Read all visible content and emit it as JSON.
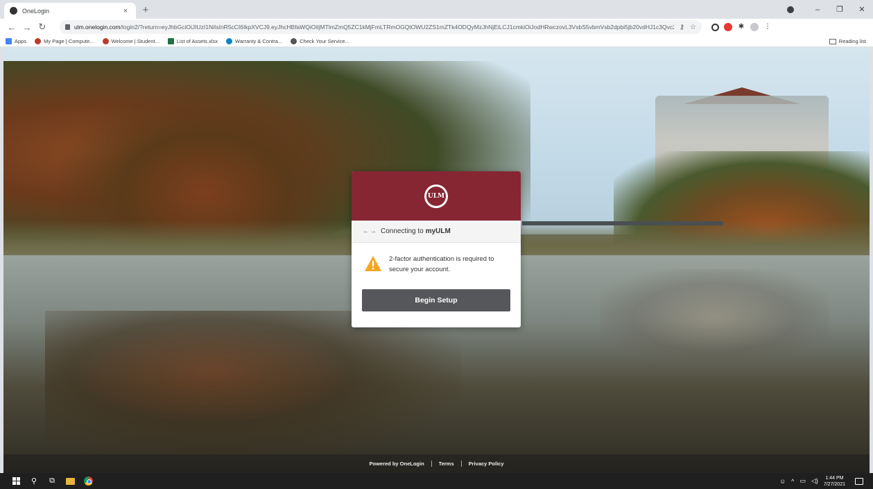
{
  "browser": {
    "tab_title": "OneLogin",
    "tab_close": "×",
    "new_tab": "+",
    "url_host": "ulm.onelogin.com",
    "url_rest": "/login2/?return=eyJhbGciOiJIUzI1NiIsInR5cCI6IkpXVCJ9.eyJhcHBfaWQiOiIjMTlmZmQ5ZC1kMjFmLTRmOGQtOWU2ZS1mZTk4ODQyMzJhNjEiLCJ1cmkiOiJodHRwczovL3VsbS5vbmVsb2dpbi5jb20vdHJ1c3Qvc2FtbDIvaHR0cDovaHR0cHM6Ly9sdWxtLWVkdS...",
    "bookmarks": [
      {
        "label": "Apps",
        "color": "#4285f4"
      },
      {
        "label": "My Page | Compute...",
        "color": "#c0392b"
      },
      {
        "label": "Welcome | Student...",
        "color": "#c0392b"
      },
      {
        "label": "List of Assets.xlsx",
        "color": "#1e7145"
      },
      {
        "label": "Warranty & Contra...",
        "color": "#0a84c6"
      },
      {
        "label": "Check Your Service...",
        "color": "#555555"
      }
    ],
    "reading_list": "Reading list"
  },
  "card": {
    "logo_text": "ULM",
    "connecting_prefix": "Connecting to",
    "connecting_app": "myULM",
    "message": "2-factor authentication is required to secure your account.",
    "button_label": "Begin Setup",
    "brand_color": "#862633"
  },
  "footer": {
    "powered_by": "Powered by OneLogin",
    "terms": "Terms",
    "privacy": "Privacy Policy"
  },
  "taskbar": {
    "time": "1:44 PM",
    "date": "7/27/2021"
  }
}
